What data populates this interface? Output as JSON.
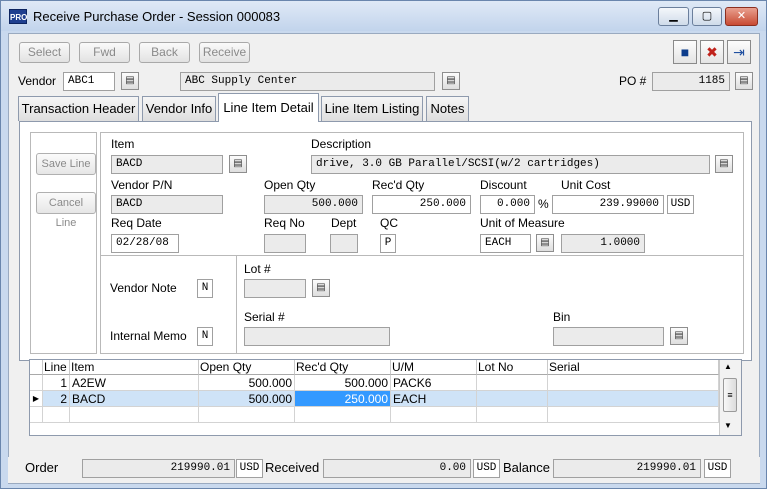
{
  "window": {
    "app_icon": "PRO",
    "title": "Receive Purchase Order - Session 000083",
    "controls": [
      "minimize-icon",
      "maximize-icon",
      "close-icon"
    ]
  },
  "toolbar": {
    "select": "Select",
    "fwd": "Fwd",
    "back": "Back",
    "receive": "Receive",
    "right_tools": [
      "save-icon",
      "delete-icon",
      "exit-icon"
    ]
  },
  "header": {
    "vendor_label": "Vendor",
    "vendor_code": "ABC1",
    "vendor_name": "ABC Supply Center",
    "po_label": "PO #",
    "po_number": "1185"
  },
  "tabs": [
    {
      "label": "Transaction Header"
    },
    {
      "label": "Vendor Info"
    },
    {
      "label": "Line Item Detail",
      "active": true
    },
    {
      "label": "Line Item Listing"
    },
    {
      "label": "Notes"
    }
  ],
  "detail": {
    "save_line": "Save Line",
    "cancel_line": "Cancel Line",
    "item_label": "Item",
    "item_value": "BACD",
    "description_label": "Description",
    "description_value": "drive, 3.0 GB Parallel/SCSI(w/2 cartridges)",
    "vendor_pn_label": "Vendor P/N",
    "vendor_pn_value": "BACD",
    "open_qty_label": "Open Qty",
    "open_qty_value": "500.000",
    "recd_qty_label": "Rec'd Qty",
    "recd_qty_value": "250.000",
    "discount_label": "Discount",
    "discount_value": "0.000",
    "percent": "%",
    "unit_cost_label": "Unit Cost",
    "unit_cost_value": "239.99000",
    "currency": "USD",
    "req_date_label": "Req Date",
    "req_date_value": "02/28/08",
    "req_no_label": "Req No",
    "req_no_value": "",
    "dept_label": "Dept",
    "dept_value": "",
    "qc_label": "QC",
    "qc_value": "P",
    "uom_label": "Unit of Measure",
    "uom_value": "EACH",
    "uom_factor": "1.0000",
    "vendor_note_label": "Vendor Note",
    "vendor_note_value": "N",
    "internal_memo_label": "Internal Memo",
    "internal_memo_value": "N",
    "lot_label": "Lot #",
    "serial_label": "Serial #",
    "bin_label": "Bin"
  },
  "grid": {
    "columns": [
      "Line",
      "Item",
      "Open Qty",
      "Rec'd Qty",
      "U/M",
      "Lot No",
      "Serial"
    ],
    "rows": [
      {
        "line": "1",
        "item": "A2EW",
        "open_qty": "500.000",
        "recd_qty": "500.000",
        "um": "PACK6",
        "lot": "",
        "serial": ""
      },
      {
        "line": "2",
        "item": "BACD",
        "open_qty": "500.000",
        "recd_qty": "250.000",
        "um": "EACH",
        "lot": "",
        "serial": ""
      }
    ],
    "selected_row": 1
  },
  "totals": {
    "order_label": "Order",
    "order_value": "219990.01",
    "received_label": "Received",
    "received_value": "0.00",
    "balance_label": "Balance",
    "balance_value": "219990.01",
    "currency": "USD"
  },
  "colors": {
    "window_frame": "#c9d9ee",
    "client_bg": "#f0f0f0",
    "selection": "#3399ff",
    "row_selected": "#cfe3f7"
  }
}
